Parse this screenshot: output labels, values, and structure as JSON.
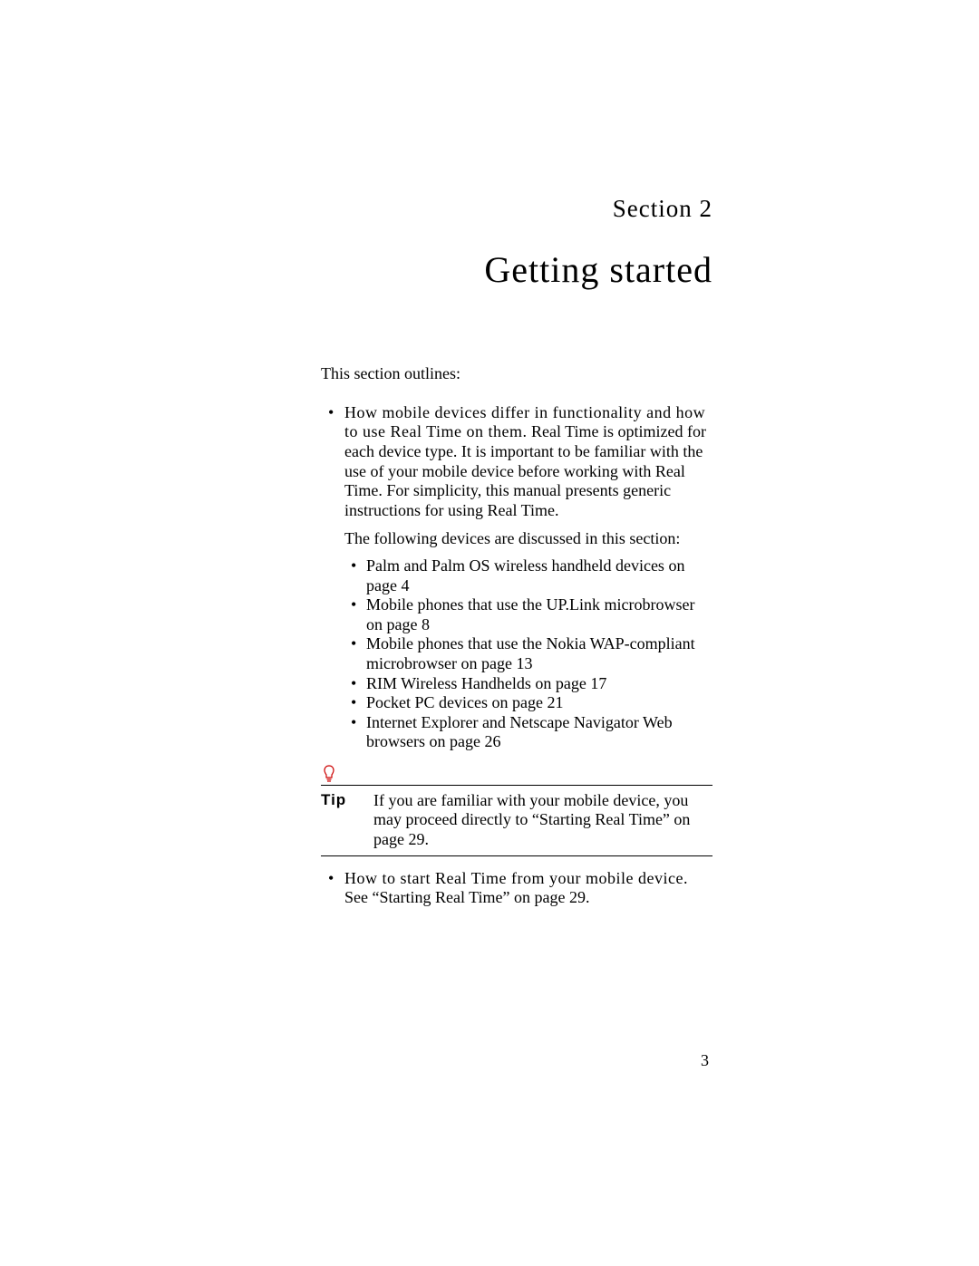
{
  "section_label": "Section 2",
  "section_title": "Getting started",
  "intro": "This section outlines:",
  "outer_item_1_lead": "How mobile devices differ in functionality and how to use Real Time on them.",
  "outer_item_1_rest": " Real Time is optimized for each device type. It is important to be familiar with the use of your mobile device before working with Real Time. For simplicity, this manual presents generic instructions for using Real Time.",
  "following_para": "The following devices are discussed in this section:",
  "inner_items": [
    "Palm and Palm OS wireless handheld devices on page 4",
    "Mobile phones that use the UP.Link microbrowser on page 8",
    "Mobile phones that use the Nokia WAP-compliant microbrowser on page 13",
    "RIM Wireless Handhelds on page 17",
    "Pocket PC devices on page 21",
    "Internet Explorer and Netscape Navigator Web browsers on page 26"
  ],
  "tip_label": "Tip",
  "tip_text": "If you are familiar with your mobile device, you may proceed directly to “Starting Real Time” on page 29.",
  "outer_item_2_lead": "How to start Real Time from your mobile device.",
  "outer_item_2_rest": " See “Starting Real Time” on page 29.",
  "page_number": "3"
}
